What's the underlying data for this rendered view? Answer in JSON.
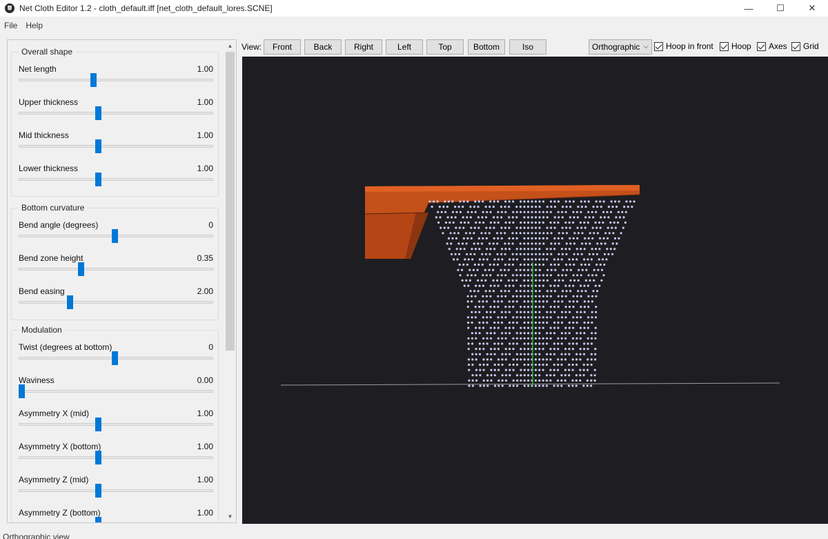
{
  "window": {
    "title": "Net Cloth Editor 1.2 - cloth_default.iff [net_cloth_default_lores.SCNE]",
    "controls": {
      "minimize": "—",
      "maximize": "☐",
      "close": "✕"
    }
  },
  "menu": {
    "items": [
      "File",
      "Help"
    ]
  },
  "groups": [
    {
      "title": "Overall shape",
      "params": [
        {
          "label": "Net length",
          "value": "1.00",
          "position": 0.385
        },
        {
          "label": "Upper thickness",
          "value": "1.00",
          "position": 0.41
        },
        {
          "label": "Mid thickness",
          "value": "1.00",
          "position": 0.41
        },
        {
          "label": "Lower thickness",
          "value": "1.00",
          "position": 0.41
        }
      ]
    },
    {
      "title": "Bottom curvature",
      "params": [
        {
          "label": "Bend angle (degrees)",
          "value": "0",
          "position": 0.5
        },
        {
          "label": "Bend zone height",
          "value": "0.35",
          "position": 0.32
        },
        {
          "label": "Bend easing",
          "value": "2.00",
          "position": 0.26
        }
      ]
    },
    {
      "title": "Modulation",
      "params": [
        {
          "label": "Twist (degrees at bottom)",
          "value": "0",
          "position": 0.5
        },
        {
          "label": "Waviness",
          "value": "0.00",
          "position": 0.0
        },
        {
          "label": "Asymmetry X (mid)",
          "value": "1.00",
          "position": 0.41
        },
        {
          "label": "Asymmetry X (bottom)",
          "value": "1.00",
          "position": 0.41
        },
        {
          "label": "Asymmetry Z (mid)",
          "value": "1.00",
          "position": 0.41
        },
        {
          "label": "Asymmetry Z (bottom)",
          "value": "1.00",
          "position": 0.41
        }
      ]
    }
  ],
  "toolbar": {
    "view_label": "View:",
    "view_buttons": [
      "Front",
      "Back",
      "Right",
      "Left",
      "Top",
      "Bottom",
      "Iso"
    ],
    "projection": "Orthographic",
    "checkboxes": [
      {
        "label": "Hoop in front",
        "checked": true
      },
      {
        "label": "Hoop",
        "checked": true
      },
      {
        "label": "Axes",
        "checked": true
      },
      {
        "label": "Grid",
        "checked": true
      }
    ]
  },
  "viewport": {
    "background": "#1e1e22",
    "hoop_color": "#c4501a",
    "vertex_color": "#c8c8f0",
    "axis_color": "#2db82d"
  },
  "status": {
    "text": "Orthographic view"
  }
}
